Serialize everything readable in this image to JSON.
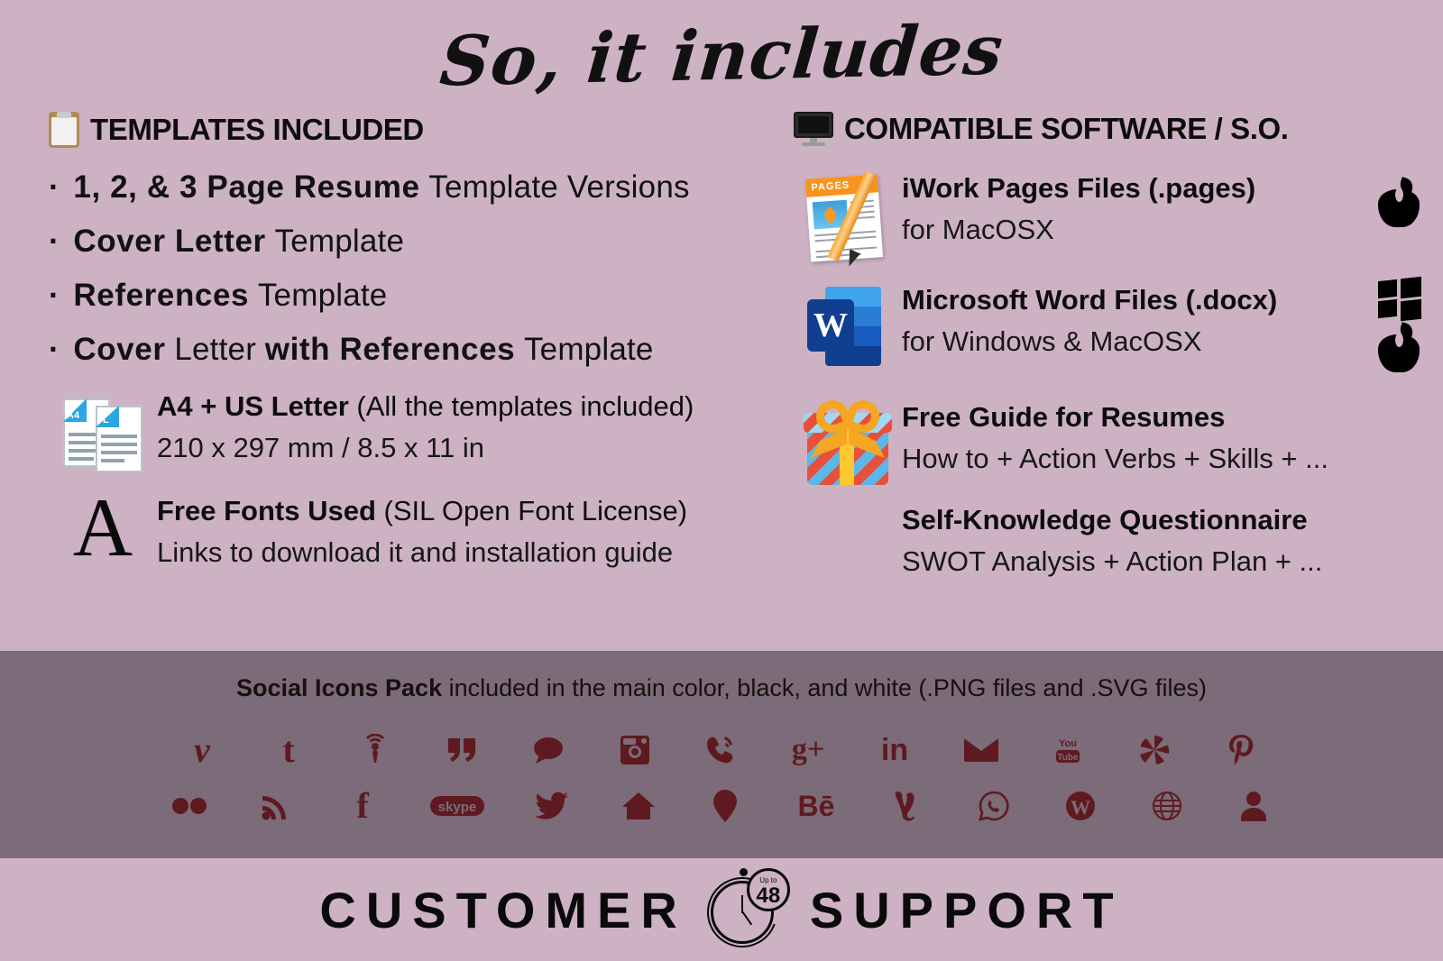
{
  "theme": {
    "background": "#cdb2c4",
    "banner_bg": "#7c6b78",
    "icon_color": "#5e1a20",
    "text": "#0d0d0d"
  },
  "title": "So, it includes",
  "left": {
    "heading": "TEMPLATES INCLUDED",
    "heading_icon": "clipboard-icon",
    "bullets": [
      {
        "bold": "1, 2, & 3 Page Resume",
        "regular": "Template Versions"
      },
      {
        "bold": "Cover Letter",
        "regular": "Template"
      },
      {
        "bold": "References",
        "regular": "Template"
      },
      {
        "bold": "Cover",
        "regular": "Letter",
        "bold2": "with References",
        "regular2": "Template"
      }
    ],
    "features": [
      {
        "icon": "a4-us-letter-docs-icon",
        "title_bold": "A4 + US Letter",
        "title_regular": "(All the templates included)",
        "subtitle": "210 x 297 mm / 8.5 x 11 in",
        "doc_labels": [
          "A4",
          "L"
        ]
      },
      {
        "icon": "serif-letter-a-icon",
        "icon_glyph": "A",
        "title_bold": "Free Fonts Used",
        "title_regular": "(SIL Open Font License)",
        "subtitle": "Links to download it and installation guide"
      }
    ]
  },
  "right": {
    "heading": "COMPATIBLE SOFTWARE / S.O.",
    "heading_icon": "monitor-icon",
    "features": [
      {
        "icon": "iwork-pages-app-icon",
        "icon_label": "PAGES",
        "title": "iWork Pages Files (.pages)",
        "subtitle": "for MacOSX",
        "os_logos": [
          "apple-logo-icon"
        ]
      },
      {
        "icon": "microsoft-word-app-icon",
        "icon_glyph": "W",
        "title": "Microsoft Word Files (.docx)",
        "subtitle": "for Windows & MacOSX",
        "os_logos": [
          "windows-logo-icon",
          "apple-logo-icon"
        ]
      },
      {
        "icon": "gift-box-icon",
        "title": "Free Guide for Resumes",
        "subtitle": "How to + Action Verbs + Skills + ..."
      },
      {
        "icon": "",
        "title": "Self-Knowledge Questionnaire",
        "subtitle": "SWOT Analysis + Action Plan + ..."
      }
    ]
  },
  "social": {
    "caption_bold": "Social Icons Pack",
    "caption_regular": "included in the main color, black, and white (.PNG files and .SVG files)",
    "row1": [
      "vimeo-icon",
      "tumblr-icon",
      "podcast-icon",
      "quote-icon",
      "chat-bubble-icon",
      "instagram-icon",
      "phone-icon",
      "google-plus-icon",
      "linkedin-icon",
      "email-icon",
      "youtube-icon",
      "google-photos-icon",
      "pinterest-icon"
    ],
    "row2": [
      "flickr-icon",
      "rss-icon",
      "facebook-icon",
      "skype-icon",
      "twitter-icon",
      "home-icon",
      "location-pin-icon",
      "behance-icon",
      "vine-icon",
      "whatsapp-icon",
      "wordpress-icon",
      "globe-www-icon",
      "person-icon"
    ],
    "glyphs": {
      "vimeo": "v",
      "tumblr": "t",
      "quote": "”",
      "google_plus": "g+",
      "linkedin": "in",
      "behance": "Bē",
      "facebook": "f",
      "skype": "skype",
      "youtube_top": "You",
      "youtube_bottom": "Tube",
      "globe": "WWW",
      "vine": "V"
    }
  },
  "footer": {
    "word1": "CUSTOMER",
    "word2": "SUPPORT",
    "stopwatch": {
      "up_to": "Up to",
      "hours": "48"
    }
  }
}
